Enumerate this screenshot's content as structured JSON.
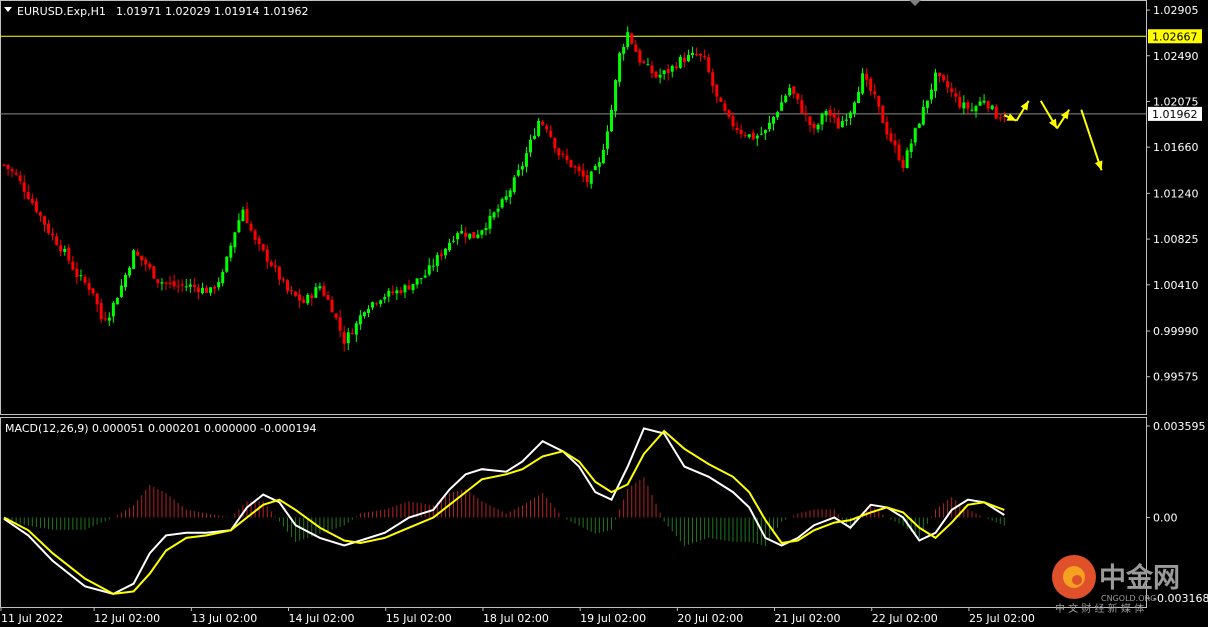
{
  "window": {
    "title": "EURUSD.Exp,H1",
    "ohlc": "1.01971 1.02029 1.01914 1.01962"
  },
  "macd": {
    "label": "MACD(12,26,9) 0.000051 0.000201 0.000000 -0.000194"
  },
  "colors": {
    "background": "#000000",
    "bull": "#00ff00",
    "bear": "#ff0000",
    "hist_pos": "#b42323",
    "hist_neg": "#1e781e",
    "macd_line": "#ffffff",
    "signal_line": "#ffff00",
    "hline": "#ffff00",
    "arrow": "#ffff00",
    "axis": "#c0c0c0"
  },
  "icons": [
    "dropdown-triangle-icon",
    "chart-shift-marker-icon",
    "watermark-logo-icon"
  ],
  "watermark": {
    "cn": "中金网",
    "en": "CNGOLD.ORG",
    "sub": "中 文 财 经 新 媒 体"
  },
  "chart_data": [
    {
      "type": "candlestick",
      "title": "EURUSD.Exp,H1",
      "ylim": [
        0.994,
        1.0296
      ],
      "y_ticks": [
        "1.02905",
        "1.02490",
        "1.02075",
        "1.01660",
        "1.01240",
        "1.00825",
        "1.00410",
        "0.99990",
        "0.99575"
      ],
      "price_tags": [
        {
          "label": "1.02667",
          "value": 1.02667,
          "style": "yellow"
        },
        {
          "label": "1.01962",
          "value": 1.01962,
          "style": "gray"
        }
      ],
      "x_ticks": [
        "11 Jul 2022",
        "12 Jul 02:00",
        "13 Jul 02:00",
        "14 Jul 02:00",
        "15 Jul 02:00",
        "18 Jul 02:00",
        "19 Jul 02:00",
        "20 Jul 02:00",
        "21 Jul 02:00",
        "22 Jul 02:00",
        "25 Jul 02:00"
      ],
      "close_keypoints": [
        [
          0,
          1.015
        ],
        [
          3,
          1.014
        ],
        [
          8,
          1.011
        ],
        [
          11,
          1.009
        ],
        [
          15,
          1.007
        ],
        [
          18,
          1.005
        ],
        [
          22,
          1.0035
        ],
        [
          24,
          1.001
        ],
        [
          26,
          1.0015
        ],
        [
          29,
          1.004
        ],
        [
          32,
          1.007
        ],
        [
          35,
          1.006
        ],
        [
          38,
          1.0045
        ],
        [
          42,
          1.004
        ],
        [
          46,
          1.004
        ],
        [
          51,
          1.0035
        ],
        [
          54,
          1.005
        ],
        [
          57,
          1.009
        ],
        [
          59,
          1.011
        ],
        [
          62,
          1.008
        ],
        [
          66,
          1.006
        ],
        [
          70,
          1.0035
        ],
        [
          74,
          1.0025
        ],
        [
          78,
          1.004
        ],
        [
          81,
          1.002
        ],
        [
          84,
          0.999
        ],
        [
          87,
          1.0005
        ],
        [
          89,
          1.002
        ],
        [
          93,
          1.003
        ],
        [
          97,
          1.0035
        ],
        [
          100,
          1.004
        ],
        [
          104,
          1.005
        ],
        [
          108,
          1.007
        ],
        [
          112,
          1.009
        ],
        [
          116,
          1.0085
        ],
        [
          120,
          1.01
        ],
        [
          124,
          1.012
        ],
        [
          128,
          1.015
        ],
        [
          132,
          1.019
        ],
        [
          134,
          1.0185
        ],
        [
          137,
          1.016
        ],
        [
          140,
          1.015
        ],
        [
          144,
          1.0135
        ],
        [
          147,
          1.015
        ],
        [
          150,
          1.02
        ],
        [
          152,
          1.025
        ],
        [
          154,
          1.027
        ],
        [
          157,
          1.0245
        ],
        [
          161,
          1.023
        ],
        [
          164,
          1.0235
        ],
        [
          167,
          1.0245
        ],
        [
          171,
          1.025
        ],
        [
          173,
          1.0245
        ],
        [
          176,
          1.021
        ],
        [
          179,
          1.019
        ],
        [
          182,
          1.018
        ],
        [
          185,
          1.0175
        ],
        [
          188,
          1.018
        ],
        [
          191,
          1.02
        ],
        [
          194,
          1.022
        ],
        [
          197,
          1.02
        ],
        [
          200,
          1.018
        ],
        [
          203,
          1.02
        ],
        [
          206,
          1.0185
        ],
        [
          209,
          1.02
        ],
        [
          212,
          1.023
        ],
        [
          215,
          1.021
        ],
        [
          218,
          1.018
        ],
        [
          222,
          1.015
        ],
        [
          224,
          1.017
        ],
        [
          227,
          1.02
        ],
        [
          230,
          1.023
        ],
        [
          233,
          1.022
        ],
        [
          236,
          1.0205
        ],
        [
          239,
          1.02
        ],
        [
          242,
          1.021
        ],
        [
          245,
          1.0195
        ],
        [
          247,
          1.0196
        ]
      ],
      "candle_count": 248,
      "forecast_arrows": [
        {
          "from": [
            247,
            1.0195
          ],
          "to": [
            250,
            1.019
          ]
        },
        {
          "from": [
            250,
            1.019
          ],
          "to": [
            253,
            1.0208
          ]
        },
        {
          "from": [
            256,
            1.0208
          ],
          "to": [
            260,
            1.0183
          ]
        },
        {
          "from": [
            260,
            1.0183
          ],
          "to": [
            263,
            1.02
          ]
        },
        {
          "from": [
            266,
            1.02
          ],
          "to": [
            271,
            1.0145
          ]
        }
      ]
    },
    {
      "type": "line",
      "title": "MACD(12,26,9)",
      "ylim": [
        -0.00316,
        0.003595
      ],
      "y_ticks": [
        "0.003595",
        "0.00",
        "-0.003168"
      ],
      "series": [
        {
          "color": "#ffffff",
          "points": [
            [
              0,
              -5e-05
            ],
            [
              6,
              -0.0007
            ],
            [
              12,
              -0.0017
            ],
            [
              20,
              -0.0027
            ],
            [
              27,
              -0.003
            ],
            [
              32,
              -0.0026
            ],
            [
              36,
              -0.0014
            ],
            [
              40,
              -0.0007
            ],
            [
              45,
              -0.0006
            ],
            [
              50,
              -0.0006
            ],
            [
              56,
              -0.0005
            ],
            [
              60,
              0.0004
            ],
            [
              64,
              0.0009
            ],
            [
              68,
              0.0006
            ],
            [
              72,
              -0.0003
            ],
            [
              78,
              -0.0008
            ],
            [
              84,
              -0.0011
            ],
            [
              88,
              -0.0009
            ],
            [
              94,
              -0.0006
            ],
            [
              100,
              0.0
            ],
            [
              106,
              0.0003
            ],
            [
              110,
              0.0011
            ],
            [
              114,
              0.0017
            ],
            [
              118,
              0.0019
            ],
            [
              124,
              0.0018
            ],
            [
              128,
              0.0022
            ],
            [
              133,
              0.003
            ],
            [
              138,
              0.0026
            ],
            [
              142,
              0.002
            ],
            [
              146,
              0.001
            ],
            [
              150,
              0.0007
            ],
            [
              154,
              0.002
            ],
            [
              158,
              0.0035
            ],
            [
              163,
              0.0033
            ],
            [
              168,
              0.002
            ],
            [
              174,
              0.0016
            ],
            [
              180,
              0.001
            ],
            [
              184,
              0.0004
            ],
            [
              188,
              -0.0008
            ],
            [
              192,
              -0.0011
            ],
            [
              196,
              -0.0008
            ],
            [
              200,
              -0.0003
            ],
            [
              205,
              0.0
            ],
            [
              209,
              -0.0004
            ],
            [
              214,
              0.0005
            ],
            [
              218,
              0.0004
            ],
            [
              222,
              0.0
            ],
            [
              226,
              -0.0009
            ],
            [
              230,
              -0.0006
            ],
            [
              234,
              0.0003
            ],
            [
              238,
              0.0007
            ],
            [
              242,
              0.0006
            ],
            [
              247,
              0.0001
            ]
          ]
        },
        {
          "color": "#ffff00",
          "points": [
            [
              0,
              0.0
            ],
            [
              6,
              -0.0005
            ],
            [
              12,
              -0.0014
            ],
            [
              20,
              -0.0024
            ],
            [
              27,
              -0.003
            ],
            [
              32,
              -0.0029
            ],
            [
              36,
              -0.0022
            ],
            [
              40,
              -0.0013
            ],
            [
              45,
              -0.0008
            ],
            [
              50,
              -0.0007
            ],
            [
              56,
              -0.0005
            ],
            [
              60,
              0.0
            ],
            [
              64,
              0.0005
            ],
            [
              68,
              0.0007
            ],
            [
              72,
              0.0003
            ],
            [
              78,
              -0.0004
            ],
            [
              84,
              -0.0009
            ],
            [
              88,
              -0.001
            ],
            [
              94,
              -0.0008
            ],
            [
              100,
              -0.0004
            ],
            [
              106,
              0.0
            ],
            [
              110,
              0.0005
            ],
            [
              114,
              0.001
            ],
            [
              118,
              0.0015
            ],
            [
              124,
              0.0017
            ],
            [
              128,
              0.0019
            ],
            [
              133,
              0.0024
            ],
            [
              138,
              0.0026
            ],
            [
              142,
              0.0022
            ],
            [
              146,
              0.0014
            ],
            [
              150,
              0.001
            ],
            [
              154,
              0.0013
            ],
            [
              158,
              0.0025
            ],
            [
              163,
              0.0034
            ],
            [
              168,
              0.0027
            ],
            [
              174,
              0.0021
            ],
            [
              180,
              0.0016
            ],
            [
              184,
              0.001
            ],
            [
              188,
              -0.0001
            ],
            [
              192,
              -0.001
            ],
            [
              196,
              -0.0009
            ],
            [
              200,
              -0.0005
            ],
            [
              205,
              -0.0002
            ],
            [
              209,
              -0.0001
            ],
            [
              214,
              0.0002
            ],
            [
              218,
              0.0004
            ],
            [
              222,
              0.0002
            ],
            [
              226,
              -0.0004
            ],
            [
              230,
              -0.0008
            ],
            [
              234,
              -0.0002
            ],
            [
              238,
              0.0005
            ],
            [
              242,
              0.0006
            ],
            [
              247,
              0.0003
            ]
          ]
        }
      ]
    }
  ]
}
